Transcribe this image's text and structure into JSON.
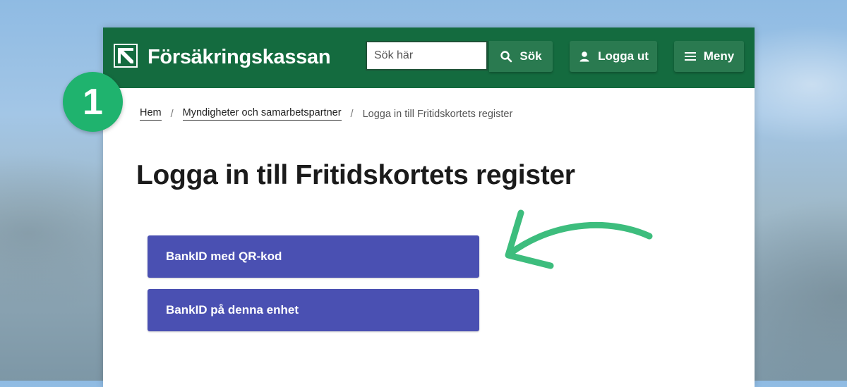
{
  "site": {
    "logo_text": "Försäkringskassan",
    "brand_color": "#146b3f"
  },
  "header": {
    "search_placeholder": "Sök här",
    "search_button": "Sök",
    "logout_button": "Logga ut",
    "menu_button": "Meny"
  },
  "step_badge": "1",
  "breadcrumb": {
    "items": [
      "Hem",
      "Myndigheter och samarbetspartner"
    ],
    "separator": "/",
    "current": "Logga in till Fritidskortets register"
  },
  "main": {
    "title": "Logga in till Fritidskortets register",
    "buttons": [
      "BankID med QR-kod",
      "BankID på denna enhet"
    ],
    "button_color": "#4a50b2"
  },
  "icons": [
    "logo-mark-icon",
    "search-icon",
    "user-icon",
    "hamburger-icon",
    "arrow-icon"
  ],
  "annotation_color": "#3dbd7d"
}
